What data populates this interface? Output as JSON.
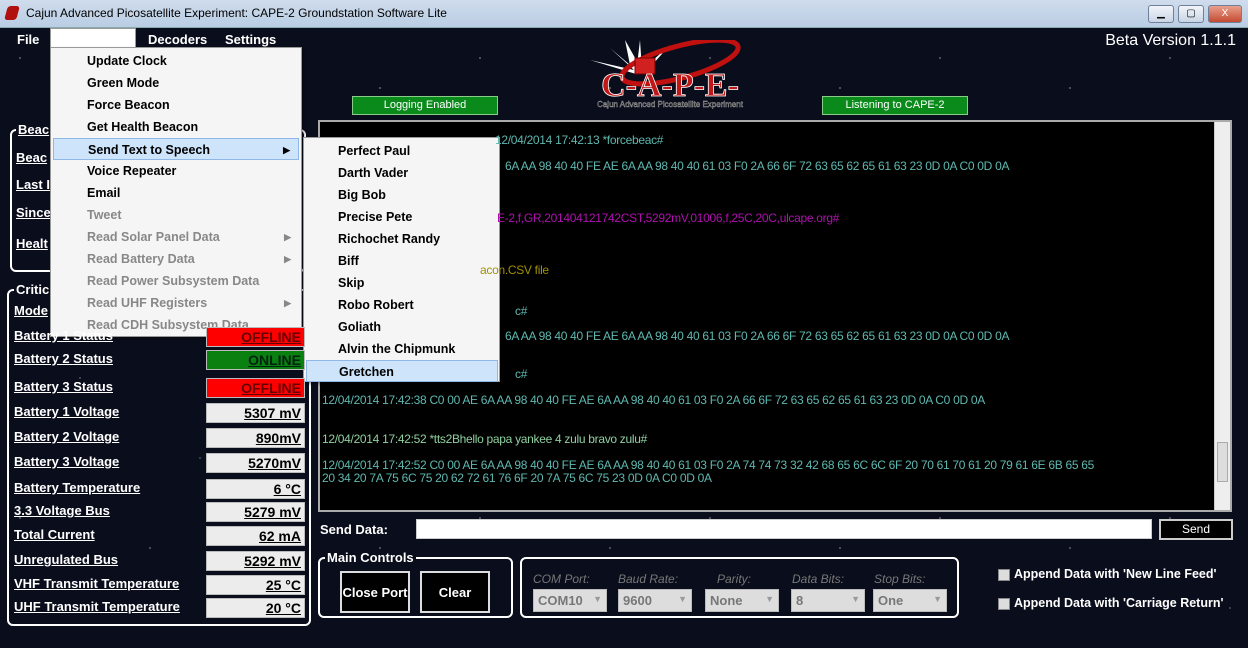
{
  "window": {
    "title": "Cajun Advanced Picosatellite Experiment: CAPE-2 Groundstation Software Lite",
    "minimize": "▁",
    "maximize": "▢",
    "close": "X"
  },
  "menubar": {
    "file": "File",
    "open": "",
    "decoders": "Decoders",
    "settings": "Settings"
  },
  "version": "Beta Version 1.1.1",
  "logo": {
    "text": "C-A-P-E-",
    "subtitle": "Cajun Advanced Picosatellite Experiment"
  },
  "status": {
    "logging": "Logging Enabled",
    "listening": "Listening to CAPE-2"
  },
  "menu": [
    {
      "label": "Update Clock",
      "disabled": false
    },
    {
      "label": "Green Mode",
      "disabled": false
    },
    {
      "label": "Force Beacon",
      "disabled": false
    },
    {
      "label": "Get Health Beacon",
      "disabled": false
    },
    {
      "label": "Send Text to Speech",
      "disabled": false,
      "submenu": true,
      "highlighted": true
    },
    {
      "label": "Voice Repeater",
      "disabled": false
    },
    {
      "label": "Email",
      "disabled": false
    },
    {
      "label": "Tweet",
      "disabled": true
    },
    {
      "label": "Read Solar Panel Data",
      "disabled": true,
      "submenu": true
    },
    {
      "label": "Read Battery Data",
      "disabled": true,
      "submenu": true
    },
    {
      "label": "Read Power Subsystem Data",
      "disabled": true
    },
    {
      "label": "Read UHF Registers",
      "disabled": true,
      "submenu": true
    },
    {
      "label": "Read CDH Subsystem Data",
      "disabled": true
    }
  ],
  "submenu": [
    "Perfect Paul",
    "Darth Vader",
    "Big Bob",
    "Precise Pete",
    "Richochet Randy",
    "Biff",
    "Skip",
    "Robo Robert",
    "Goliath",
    "Alvin the Chipmunk",
    "Gretchen"
  ],
  "beacon_group": {
    "title": "Beac",
    "labels": [
      "Beac",
      "Last I",
      "Since",
      "Healt"
    ]
  },
  "critical": {
    "title": "Critic",
    "rows": [
      {
        "label": "Mode",
        "value": ""
      },
      {
        "label": "Battery 1 Status",
        "value": "OFFLINE",
        "state": "red"
      },
      {
        "label": "Battery 2 Status",
        "value": "ONLINE",
        "state": "green"
      },
      {
        "label": "Battery 3 Status",
        "value": "OFFLINE",
        "state": "red"
      },
      {
        "label": "Battery 1 Voltage",
        "value": "5307 mV"
      },
      {
        "label": "Battery 2 Voltage",
        "value": "890mV"
      },
      {
        "label": "Battery 3 Voltage",
        "value": "5270mV"
      },
      {
        "label": "Battery Temperature",
        "value": "6 °C"
      },
      {
        "label": "3.3 Voltage Bus",
        "value": "5279 mV"
      },
      {
        "label": "Total Current",
        "value": "62 mA"
      },
      {
        "label": "Unregulated Bus",
        "value": "5292 mV"
      },
      {
        "label": "VHF Transmit Temperature",
        "value": "25 °C"
      },
      {
        "label": "UHF Transmit Temperature",
        "value": "20 °C"
      }
    ]
  },
  "log": [
    {
      "text": "12/04/2014 17:42:13 *forcebeac#",
      "color": "teal"
    },
    {
      "text": "6A AA 98 40 40 FE AE 6A AA 98 40 40 61 03 F0 2A 66 6F 72 63 65 62 65 61 63 23 0D 0A C0 0D 0A",
      "color": "teal"
    },
    {
      "text": "E-2,f,GR,201404121742CST,5292mV,01006,f,25C,20C,ulcape.org#",
      "color": "mag"
    },
    {
      "text": "acon.CSV file",
      "color": "olive"
    },
    {
      "text": "c#",
      "color": "teal"
    },
    {
      "text": "6A AA 98 40 40 FE AE 6A AA 98 40 40 61 03 F0 2A 66 6F 72 63 65 62 65 61 63 23 0D 0A C0 0D 0A",
      "color": "teal"
    },
    {
      "text": "c#",
      "color": "teal"
    },
    {
      "text": "12/04/2014 17:42:38 C0 00 AE 6A AA 98 40 40 FE AE 6A AA 98 40 40 61 03 F0 2A 66 6F 72 63 65 62 65 61 63 23 0D 0A C0 0D 0A",
      "color": "teal"
    },
    {
      "text": "12/04/2014 17:42:52 *tts2Bhello papa yankee 4 zulu bravo zulu#",
      "color": "grn"
    },
    {
      "text": "12/04/2014 17:42:52 C0 00 AE 6A AA 98 40 40 FE AE 6A AA 98 40 40 61 03 F0 2A 74 74 73 32 42 68 65 6C 6C 6F 20 70 61 70 61 20 79 61 6E 6B 65 65",
      "color": "teal"
    },
    {
      "text": "20 34 20 7A 75 6C 75 20 62 72 61 76 6F 20 7A 75 6C 75 23 0D 0A C0 0D 0A",
      "color": "teal"
    }
  ],
  "send": {
    "label": "Send Data:",
    "value": "",
    "button": "Send"
  },
  "main_controls": {
    "title": "Main Controls",
    "close_port": "Close Port",
    "clear": "Clear"
  },
  "serial": {
    "com_label": "COM Port:",
    "com": "COM10",
    "baud_label": "Baud Rate:",
    "baud": "9600",
    "parity_label": "Parity:",
    "parity": "None",
    "databits_label": "Data Bits:",
    "databits": "8",
    "stopbits_label": "Stop Bits:",
    "stopbits": "One"
  },
  "options": {
    "newline": "Append Data with 'New Line Feed'",
    "carriage": "Append Data with 'Carriage Return'"
  }
}
